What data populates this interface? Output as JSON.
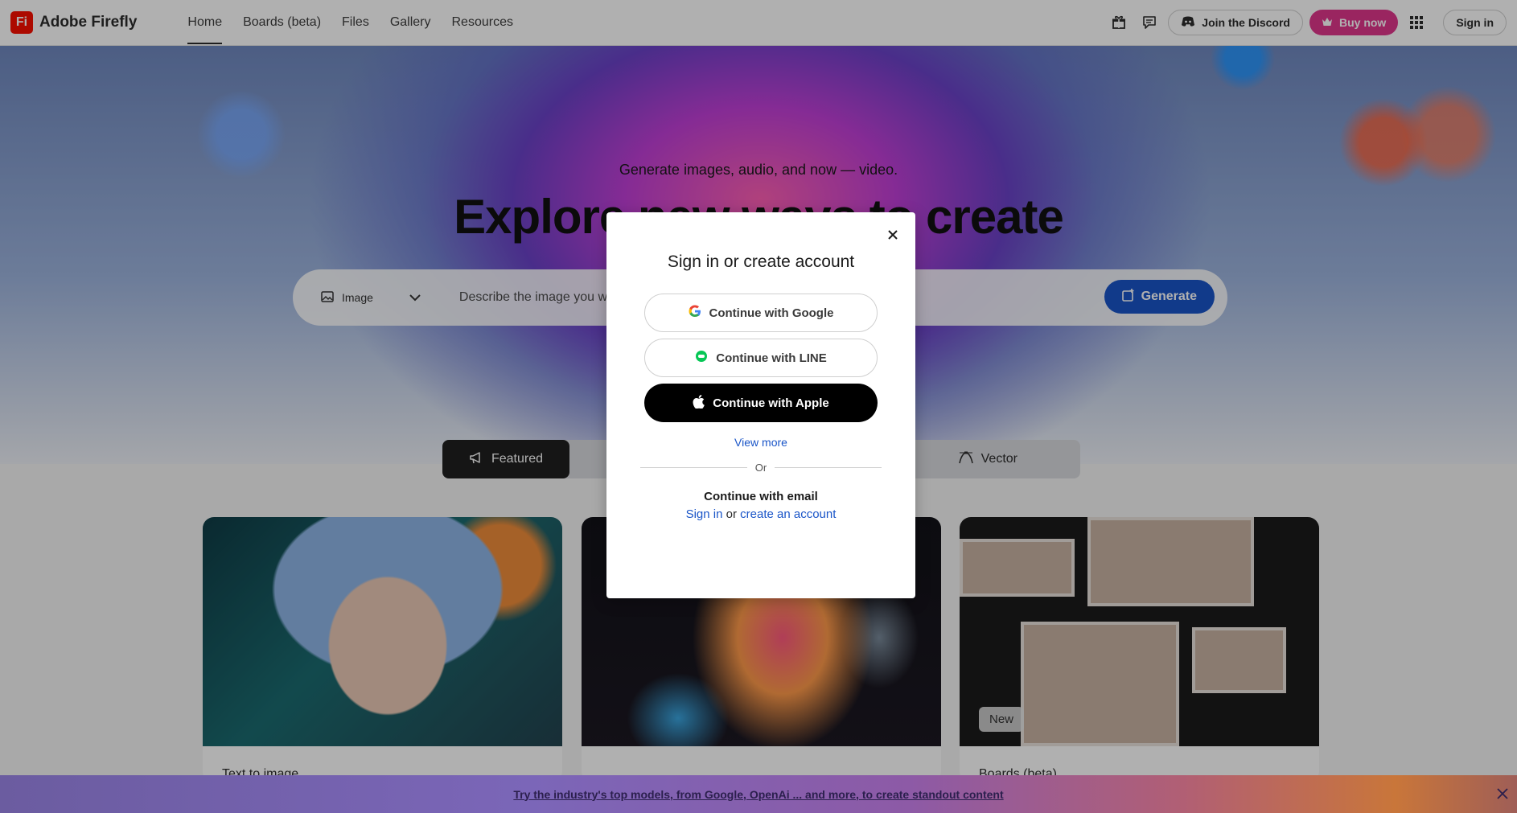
{
  "topbar": {
    "brand_logo": "Fi",
    "brand_name": "Adobe Firefly",
    "nav": [
      {
        "label": "Home",
        "active": true
      },
      {
        "label": "Boards (beta)",
        "active": false
      },
      {
        "label": "Files",
        "active": false
      },
      {
        "label": "Gallery",
        "active": false
      },
      {
        "label": "Resources",
        "active": false
      }
    ],
    "discord_label": "Join the Discord",
    "buy_label": "Buy now",
    "signin_label": "Sign in"
  },
  "hero": {
    "subtitle": "Generate images, audio, and now — video.",
    "title": "Explore new ways to create",
    "prompt_type": "Image",
    "prompt_placeholder": "Describe the image you want",
    "generate_label": "Generate"
  },
  "tabs": {
    "featured": "Featured",
    "vector": "Vector"
  },
  "cards": {
    "card1_title": "Text to image",
    "card3_title": "Boards (beta)",
    "card3_badge": "New"
  },
  "banner": {
    "text": "Try the industry's top models, from Google, OpenAi ... and more, to create standout content"
  },
  "modal": {
    "title": "Sign in or create account",
    "google": "Continue with Google",
    "line": "Continue with LINE",
    "apple": "Continue with Apple",
    "view_more": "View more",
    "or": "Or",
    "email_title": "Continue with email",
    "signin_link": "Sign in",
    "or_word": "or",
    "create_link": "create an account"
  },
  "colors": {
    "brand_red": "#fa0f00",
    "buy_pink": "#e0368c",
    "accent_blue": "#1a55c8"
  }
}
